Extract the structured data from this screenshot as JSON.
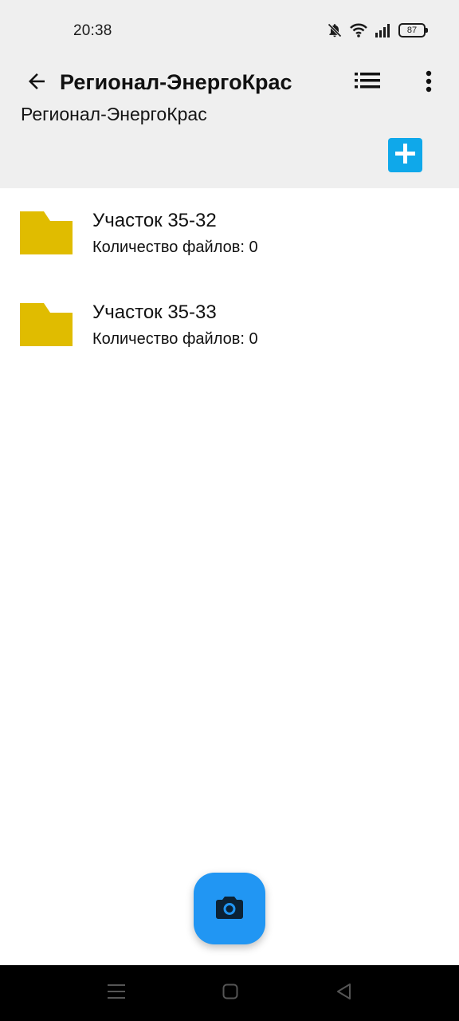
{
  "status_bar": {
    "time": "20:38",
    "battery": "87",
    "icons": [
      "bell-off-icon",
      "wifi-icon",
      "signal-icon",
      "battery-icon"
    ]
  },
  "app_bar": {
    "title": "Регионал-ЭнергоКрас",
    "subtitle": "Регионал-ЭнергоКрас",
    "icons": [
      "arrow-back-icon",
      "list-view-icon",
      "more-vert-icon",
      "add-icon"
    ]
  },
  "folders": [
    {
      "name": "Участок 35-32",
      "count": "Количество файлов: 0"
    },
    {
      "name": "Участок 35-33",
      "count": "Количество файлов: 0"
    }
  ],
  "fab": {
    "icon": "camera-icon"
  },
  "nav_bar": {
    "icons": [
      "recents-icon",
      "home-icon",
      "back-icon"
    ]
  },
  "colors": {
    "header_bg": "#efefef",
    "add_button": "#0fa8ea",
    "fab": "#2196f3",
    "folder": "#e0bc00",
    "nav_bar": "#000000"
  }
}
